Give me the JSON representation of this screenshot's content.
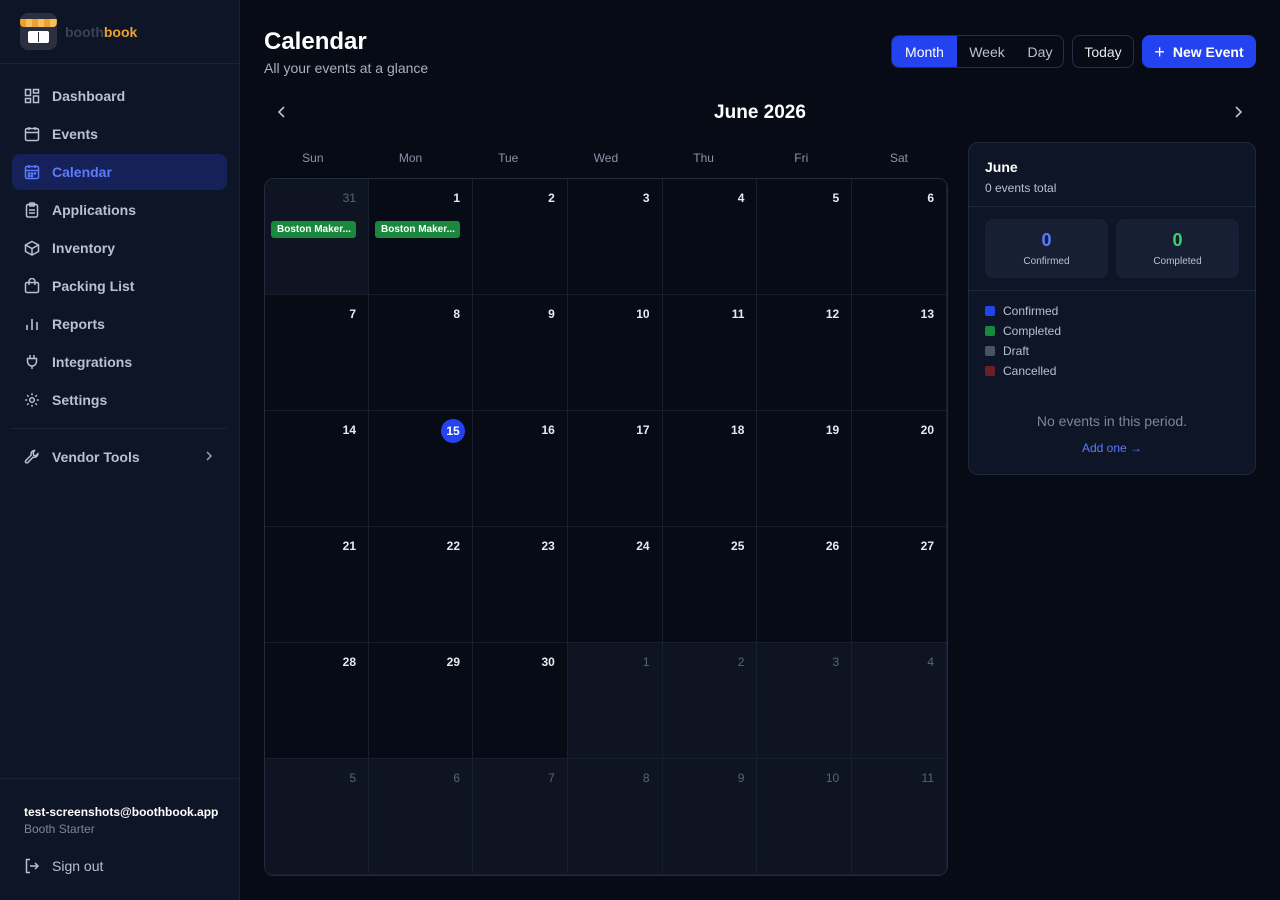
{
  "brand": {
    "name_part1": "booth",
    "name_part2": "book"
  },
  "sidebar": {
    "items": [
      {
        "label": "Dashboard",
        "icon": "dashboard-icon"
      },
      {
        "label": "Events",
        "icon": "calendar-icon"
      },
      {
        "label": "Calendar",
        "icon": "calendar-grid-icon",
        "active": true
      },
      {
        "label": "Applications",
        "icon": "clipboard-icon"
      },
      {
        "label": "Inventory",
        "icon": "box-icon"
      },
      {
        "label": "Packing List",
        "icon": "bag-icon"
      },
      {
        "label": "Reports",
        "icon": "bar-chart-icon"
      },
      {
        "label": "Integrations",
        "icon": "plug-icon"
      },
      {
        "label": "Settings",
        "icon": "gear-icon"
      }
    ],
    "vendor_tools": {
      "label": "Vendor Tools",
      "icon": "wrench-icon"
    },
    "footer": {
      "email": "test-screenshots@boothbook.app",
      "plan": "Booth Starter",
      "sign_out": "Sign out"
    }
  },
  "header": {
    "title": "Calendar",
    "subtitle": "All your events at a glance",
    "views": [
      "Month",
      "Week",
      "Day"
    ],
    "active_view": "Month",
    "today_label": "Today",
    "new_event_label": "New Event"
  },
  "calendar": {
    "month_label": "June 2026",
    "weekdays": [
      "Sun",
      "Mon",
      "Tue",
      "Wed",
      "Thu",
      "Fri",
      "Sat"
    ],
    "days": [
      {
        "n": "31",
        "out": true,
        "event": "Boston Maker..."
      },
      {
        "n": "1",
        "event": "Boston Maker..."
      },
      {
        "n": "2"
      },
      {
        "n": "3"
      },
      {
        "n": "4"
      },
      {
        "n": "5"
      },
      {
        "n": "6"
      },
      {
        "n": "7"
      },
      {
        "n": "8"
      },
      {
        "n": "9"
      },
      {
        "n": "10"
      },
      {
        "n": "11"
      },
      {
        "n": "12"
      },
      {
        "n": "13"
      },
      {
        "n": "14"
      },
      {
        "n": "15",
        "today": true
      },
      {
        "n": "16"
      },
      {
        "n": "17"
      },
      {
        "n": "18"
      },
      {
        "n": "19"
      },
      {
        "n": "20"
      },
      {
        "n": "21"
      },
      {
        "n": "22"
      },
      {
        "n": "23"
      },
      {
        "n": "24"
      },
      {
        "n": "25"
      },
      {
        "n": "26"
      },
      {
        "n": "27"
      },
      {
        "n": "28"
      },
      {
        "n": "29"
      },
      {
        "n": "30"
      },
      {
        "n": "1",
        "out": true
      },
      {
        "n": "2",
        "out": true
      },
      {
        "n": "3",
        "out": true
      },
      {
        "n": "4",
        "out": true
      },
      {
        "n": "5",
        "out": true
      },
      {
        "n": "6",
        "out": true
      },
      {
        "n": "7",
        "out": true
      },
      {
        "n": "8",
        "out": true
      },
      {
        "n": "9",
        "out": true
      },
      {
        "n": "10",
        "out": true
      },
      {
        "n": "11",
        "out": true
      }
    ]
  },
  "summary": {
    "month": "June",
    "total": "0 events total",
    "confirmed_value": "0",
    "confirmed_label": "Confirmed",
    "completed_value": "0",
    "completed_label": "Completed",
    "legend": [
      {
        "label": "Confirmed",
        "color": "#2443f0"
      },
      {
        "label": "Completed",
        "color": "#18883c"
      },
      {
        "label": "Draft",
        "color": "#4b5363"
      },
      {
        "label": "Cancelled",
        "color": "#6b1f26"
      }
    ],
    "empty_text": "No events in this period.",
    "add_link": "Add one →"
  },
  "colors": {
    "accent": "#2443f0",
    "confirmed_value": "#5b7bff",
    "completed_value": "#3fd06e"
  }
}
